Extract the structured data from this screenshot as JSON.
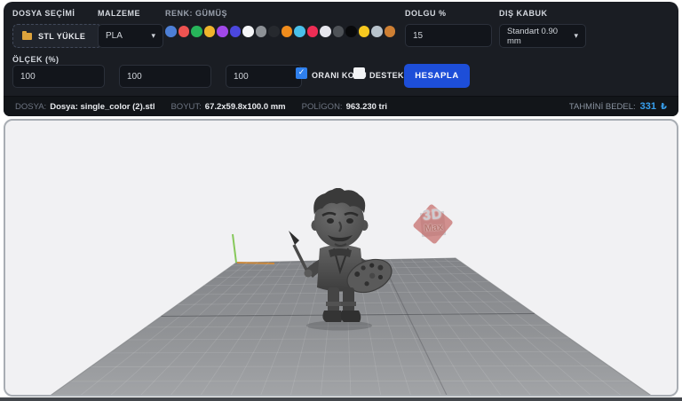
{
  "header": {
    "file": {
      "label": "DOSYA SEÇİMİ",
      "upload_button": "STL YÜKLE"
    },
    "material": {
      "label": "MALZEME",
      "selected": "PLA"
    },
    "color": {
      "label": "RENK: GÜMÜŞ",
      "selected_name": "GÜMÜŞ",
      "swatches": [
        "#4d7fd6",
        "#ee5351",
        "#27b45a",
        "#f0b42c",
        "#a148e8",
        "#4b47dd",
        "#f5f6f8",
        "#8d9196",
        "#26292e",
        "#f08c1c",
        "#49c0ea",
        "#ee2d55",
        "#e6e6ed",
        "#4e5257",
        "#08090b",
        "#f6c81f",
        "#b7c2cb",
        "#ce7f33"
      ]
    },
    "infill": {
      "label": "DOLGU %",
      "value": "15"
    },
    "shell": {
      "label": "DIŞ KABUK",
      "selected": "Standart 0.90 mm"
    },
    "scale": {
      "label": "ÖLÇEK (%)",
      "x": "100",
      "y": "100",
      "z": "100"
    },
    "keep_ratio": {
      "label": "ORANI KORU",
      "checked": true
    },
    "support": {
      "label": "DESTEK",
      "checked": false
    },
    "calculate": {
      "label": "HESAPLA"
    }
  },
  "status": {
    "file_label": "DOSYA:",
    "file_value": "Dosya: single_color (2).stl",
    "size_label": "BOYUT:",
    "size_value": "67.2x59.8x100.0 mm",
    "polygon_label": "POLİGON:",
    "polygon_value": "963.230 tri",
    "estimate_label": "TAHMİNİ BEDEL:",
    "estimate_value": "331",
    "estimate_currency": "₺"
  },
  "viewport": {
    "watermark_line1": "3D",
    "watermark_line2": "Max"
  },
  "icons": {
    "chevron_down": "▾",
    "check": "✓"
  },
  "theme": {
    "accent_blue": "#1d4ed8",
    "checked_blue": "#2f80ed",
    "price_blue": "#38a1f0",
    "panel_bg": "#1a1d23",
    "statusbar_bg": "#121519",
    "viewport_bg": "#f1f1f3",
    "axis_green": "#86c85a",
    "axis_orange": "#cc8a3d"
  }
}
